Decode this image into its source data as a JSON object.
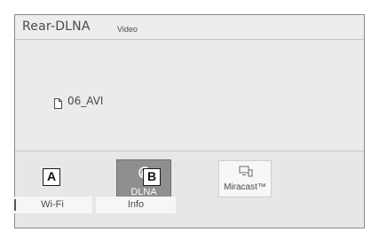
{
  "header": {
    "title": "Rear-DLNA",
    "subtitle": "Video"
  },
  "content": {
    "file_name": "06_AVI",
    "file_icon": "document-icon"
  },
  "sources": [
    {
      "label": "DLNA",
      "icon": "dlna-icon",
      "selected": true
    },
    {
      "label": "Miracast™",
      "icon": "miracast-icon",
      "selected": false
    }
  ],
  "tabs": [
    {
      "label": "Wi-Fi"
    },
    {
      "label": "Info"
    }
  ],
  "callouts": {
    "a": "A",
    "b": "B"
  },
  "colors": {
    "screen_bg": "#ededed",
    "selected_button": "#8f8f8f",
    "text": "#4a4a4a"
  }
}
